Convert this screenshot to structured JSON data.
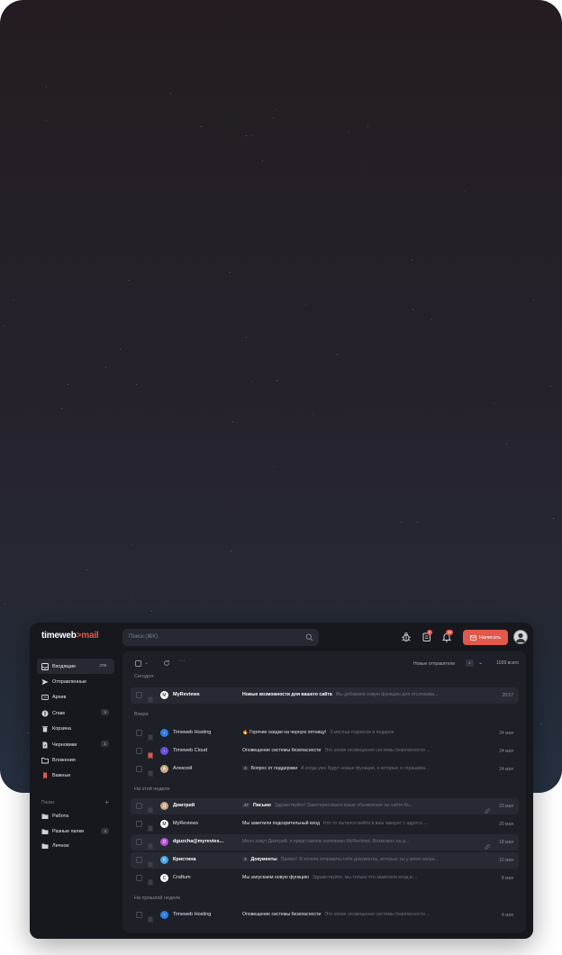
{
  "colors": {
    "accent": "#e0594b",
    "sidebar_bg": "#16181e",
    "panel_bg": "#1d2027",
    "highlight_row": "#272a32"
  },
  "app": {
    "logo_text": "timeweb",
    "logo_sep": ">",
    "logo_mail": "mail"
  },
  "header": {
    "search_placeholder": "Поиск (⌘K)",
    "notif_badge_1": "2",
    "notif_badge_2": "32",
    "compose_label": "Написать"
  },
  "sidebar": {
    "items": [
      {
        "label": "Входящие",
        "count": "278",
        "icon": "inbox-icon",
        "active": true
      },
      {
        "label": "Отправленные",
        "count": "",
        "icon": "send-icon"
      },
      {
        "label": "Архив",
        "count": "",
        "icon": "archive-icon"
      },
      {
        "label": "Спам",
        "count": "4",
        "icon": "spam-icon"
      },
      {
        "label": "Корзина",
        "count": "",
        "icon": "trash-icon"
      },
      {
        "label": "Черновики",
        "count": "1",
        "icon": "drafts-icon"
      },
      {
        "label": "Вложения",
        "count": "",
        "icon": "attachments-icon"
      },
      {
        "label": "Важные",
        "count": "",
        "icon": "bookmark-icon"
      }
    ],
    "folders_title": "Папки",
    "folders": [
      {
        "label": "Работа",
        "count": ""
      },
      {
        "label": "Разные папки",
        "count": "4"
      },
      {
        "label": "Личное",
        "count": ""
      }
    ]
  },
  "toolbar": {
    "filter_label": "Новые отправители",
    "filter_count": "4",
    "total": "1039 всего"
  },
  "groups": [
    {
      "title": "Сегодня",
      "rows": [
        {
          "from": "MyReviews",
          "bold": true,
          "highlight": true,
          "flag": false,
          "avatar": "#ffffff",
          "avatar_fg": "#000000",
          "avatar_char": "M",
          "badge": "",
          "subject": "Новые возможности для вашего сайта",
          "preview": "Мы добавили новую функцию для отслежива...",
          "clip": false,
          "date": "20:57"
        }
      ]
    },
    {
      "title": "Вчера",
      "rows": [
        {
          "from": "Timeweb Hosting",
          "bold": false,
          "highlight": false,
          "flag": false,
          "avatar": "#2f7ee8",
          "avatar_fg": "#ffffff",
          "avatar_char": "›",
          "badge": "",
          "subject": "🔥 Горячие скидки на черную пятницу!",
          "preview": "3 месяца подписки в подарок",
          "clip": false,
          "date": "24 мая"
        },
        {
          "from": "Timeweb Cloud",
          "bold": false,
          "highlight": false,
          "flag": true,
          "avatar": "#6b4ee6",
          "avatar_fg": "#ffffff",
          "avatar_char": "›",
          "badge": "",
          "subject": "Оповещение системы безопасности",
          "preview": "Это копия оповещения системы безопасности ...",
          "clip": false,
          "date": "24 мая"
        },
        {
          "from": "Алексей",
          "bold": false,
          "highlight": false,
          "flag": false,
          "avatar": "#c9a98e",
          "avatar_fg": "#ffffff",
          "avatar_char": "А",
          "badge": "3",
          "subject": "Вопрос от поддержки",
          "preview": "А когда уже будут новые функции, о которых я спрашива...",
          "clip": false,
          "date": "24 мая"
        }
      ]
    },
    {
      "title": "На этой неделе",
      "rows": [
        {
          "from": "Дмитрий",
          "bold": true,
          "highlight": true,
          "flag": false,
          "avatar": "#c7a48a",
          "avatar_fg": "#ffffff",
          "avatar_char": "Д",
          "badge": "27",
          "subject": "Письмо",
          "preview": "Здравствуйте! Заинтересовало ваше объявление на сайте Ku...",
          "clip": true,
          "date": "23 мая"
        },
        {
          "from": "MyReviews",
          "bold": false,
          "highlight": false,
          "flag": false,
          "avatar": "#ffffff",
          "avatar_fg": "#000000",
          "avatar_char": "M",
          "badge": "",
          "subject": "Мы заметили подозрительный вход",
          "preview": "Кто-то пытался войти в ваш аккаунт с адреса ...",
          "clip": false,
          "date": "20 мая"
        },
        {
          "from": "dguzcha@myrevies...",
          "bold": true,
          "highlight": true,
          "flag": false,
          "avatar": "#b34fd1",
          "avatar_fg": "#ffffff",
          "avatar_char": "D",
          "badge": "",
          "subject": "",
          "preview": "Меня зовут Дмитрий, я представляю компанию MyReviews. Возможно на д...",
          "clip": true,
          "date": "18 мая"
        },
        {
          "from": "Кристина",
          "bold": true,
          "highlight": true,
          "flag": false,
          "avatar": "#4aa3e0",
          "avatar_fg": "#ffffff",
          "avatar_char": "К",
          "badge": "3",
          "subject": "Документы",
          "preview": "Привет! Я хотела отправить тебе документы, которые ты у меня запра...",
          "clip": false,
          "date": "10 мая"
        },
        {
          "from": "Craftum",
          "bold": false,
          "highlight": false,
          "flag": false,
          "avatar": "#ffffff",
          "avatar_fg": "#000000",
          "avatar_char": "C",
          "badge": "",
          "subject": "Мы запускаем новую функцию",
          "preview": "Здравствуйте, мы только что заметили вход в ...",
          "clip": false,
          "date": "8 мая"
        }
      ]
    },
    {
      "title": "На прошлой неделе",
      "rows": [
        {
          "from": "Timeweb Hosting",
          "bold": false,
          "highlight": false,
          "flag": false,
          "avatar": "#2f7ee8",
          "avatar_fg": "#ffffff",
          "avatar_char": "›",
          "badge": "",
          "subject": "Оповещение системы безопасности",
          "preview": "Это копия оповещения системы безопасности ...",
          "clip": false,
          "date": "4 мая"
        }
      ]
    }
  ]
}
